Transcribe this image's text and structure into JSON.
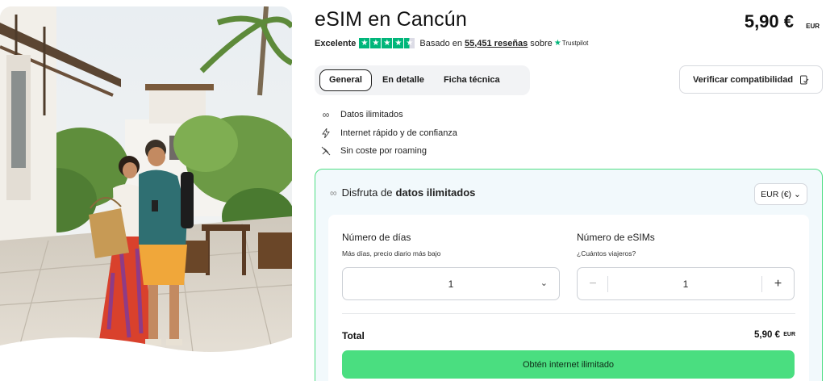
{
  "product": {
    "title": "eSIM en Cancún",
    "price": "5,90 €",
    "price_currency": "EUR"
  },
  "rating": {
    "label": "Excelente",
    "stars": 4.5,
    "based_on": "Basado en",
    "reviews": "55,451 reseñas",
    "source_prefix": "sobre",
    "source": "Trustpilot",
    "brand_color": "#00b67a"
  },
  "tabs": [
    {
      "label": "General",
      "active": true
    },
    {
      "label": "En detalle",
      "active": false
    },
    {
      "label": "Ficha técnica",
      "active": false
    }
  ],
  "verify_button": {
    "label": "Verificar compatibilidad",
    "icon": "phone-check-icon"
  },
  "features": [
    {
      "icon": "infinity-icon",
      "label": "Datos ilimitados"
    },
    {
      "icon": "bolt-icon",
      "label": "Internet rápido y de confianza"
    },
    {
      "icon": "no-roaming-icon",
      "label": "Sin coste por roaming"
    }
  ],
  "plan": {
    "heading_prefix": "Disfruta de",
    "heading_bold": "datos ilimitados",
    "currency_select": "EUR (€)",
    "accent_color": "#4ade80",
    "days": {
      "label": "Número de días",
      "hint": "Más días, precio diario más bajo",
      "value": "1"
    },
    "esims": {
      "label": "Número de eSIMs",
      "hint": "¿Cuántos viajeros?",
      "value": "1",
      "minus": "−",
      "plus": "+"
    },
    "total_label": "Total",
    "total_value": "5,90 €",
    "total_currency": "EUR",
    "cta": "Obtén internet ilimitado"
  }
}
